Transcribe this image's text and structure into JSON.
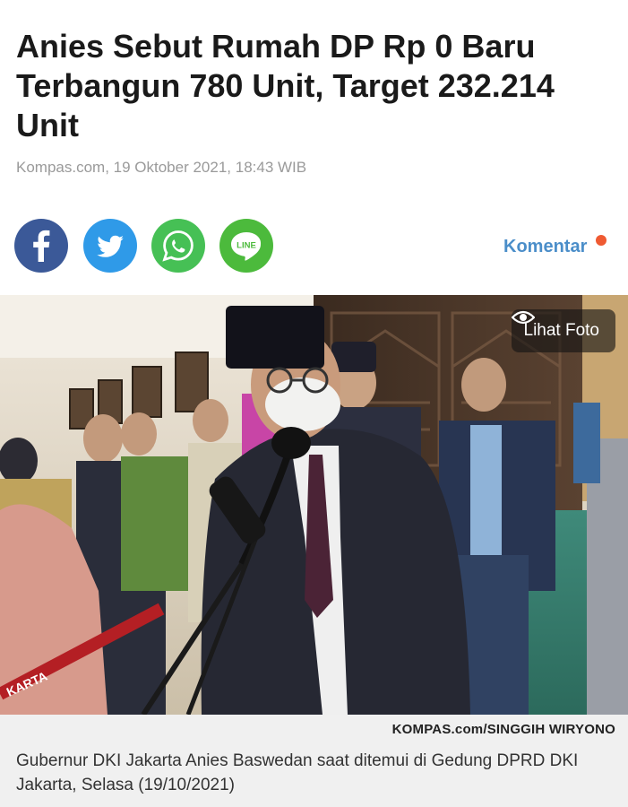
{
  "article": {
    "headline": "Anies Sebut Rumah DP Rp 0 Baru Terbangun 780 Unit, Target 232.214 Unit",
    "source_date": "Kompas.com, 19 Oktober 2021, 18:43 WIB"
  },
  "share": {
    "buttons": [
      {
        "name": "facebook",
        "icon": "facebook-icon",
        "color": "#3b5998"
      },
      {
        "name": "twitter",
        "icon": "twitter-icon",
        "color": "#2f9ae8"
      },
      {
        "name": "whatsapp",
        "icon": "whatsapp-icon",
        "color": "#46c055"
      },
      {
        "name": "line",
        "icon": "line-icon",
        "label": "LINE",
        "color": "#4cba3c"
      }
    ],
    "komentar_label": "Komentar",
    "komentar_color": "#4b8ec9",
    "notification_dot_color": "#ef5a32"
  },
  "photo": {
    "lihat_foto_label": "Lihat Foto",
    "lihat_foto_icon": "eye-icon",
    "credit": "KOMPAS.com/SINGGIH WIRYONO",
    "caption": "Gubernur DKI Jakarta Anies Baswedan saat ditemui di Gedung DPRD DKI Jakarta, Selasa (19/10/2021)",
    "banner_text": "KARTA"
  }
}
